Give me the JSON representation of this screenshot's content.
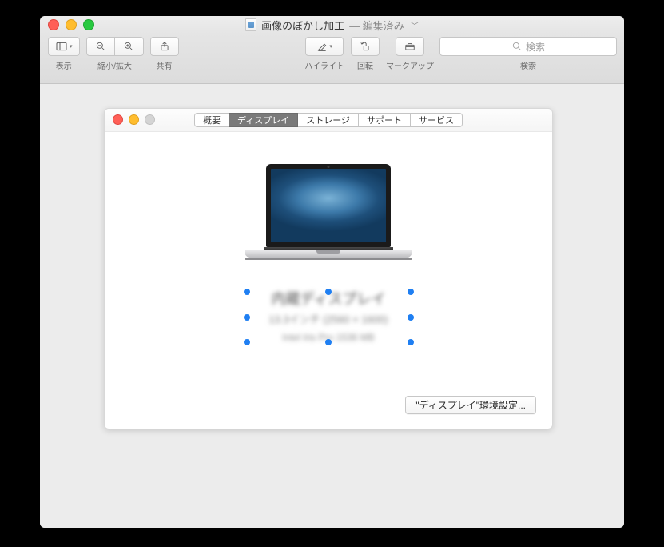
{
  "window": {
    "title": "画像のぼかし加工",
    "edited_suffix": "— 編集済み"
  },
  "toolbar": {
    "view_label": "表示",
    "zoom_label": "縮小/拡大",
    "share_label": "共有",
    "highlight_label": "ハイライト",
    "rotate_label": "回転",
    "markup_label": "マークアップ",
    "search_label": "検索",
    "search_placeholder": "検索"
  },
  "inner": {
    "tabs": [
      "概要",
      "ディスプレイ",
      "ストレージ",
      "サポート",
      "サービス"
    ],
    "selected_tab_index": 1,
    "prefs_button": "\"ディスプレイ\"環境設定..."
  }
}
